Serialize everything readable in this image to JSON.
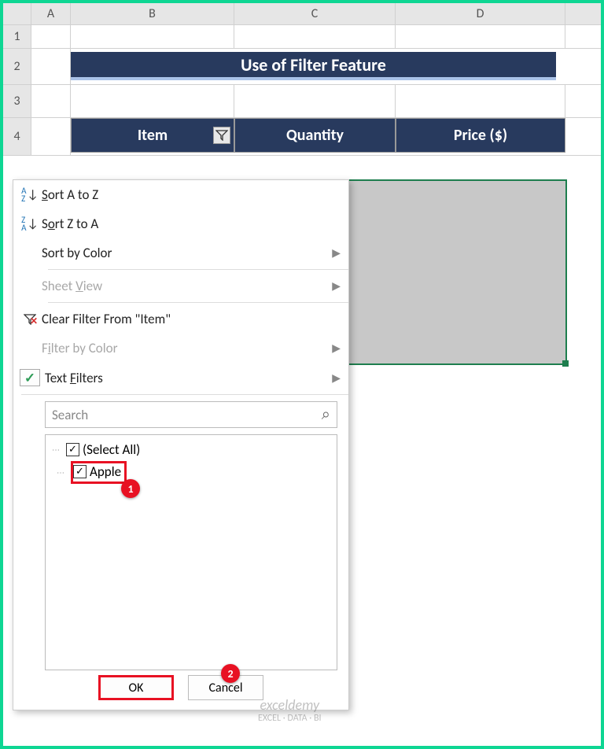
{
  "columns": {
    "A": "A",
    "B": "B",
    "C": "C",
    "D": "D"
  },
  "rows": {
    "r1": "1",
    "r2": "2",
    "r3": "3",
    "r4": "4"
  },
  "title": "Use of Filter Feature",
  "headers": {
    "item": "Item",
    "quantity": "Quantity",
    "price": "Price ($)"
  },
  "menu": {
    "sort_az": "Sort A to Z",
    "sort_za": "Sort Z to A",
    "sort_color": "Sort by Color",
    "sheet_view": "Sheet View",
    "clear_filter": "Clear Filter From \"Item\"",
    "filter_color": "Filter by Color",
    "text_filters": "Text Filters",
    "search_placeholder": "Search"
  },
  "filter_items": {
    "select_all": "(Select All)",
    "apple": "Apple"
  },
  "buttons": {
    "ok": "OK",
    "cancel": "Cancel"
  },
  "callouts": {
    "c1": "1",
    "c2": "2"
  },
  "watermark": {
    "line1": "exceldemy",
    "line2": "EXCEL · DATA · BI"
  }
}
